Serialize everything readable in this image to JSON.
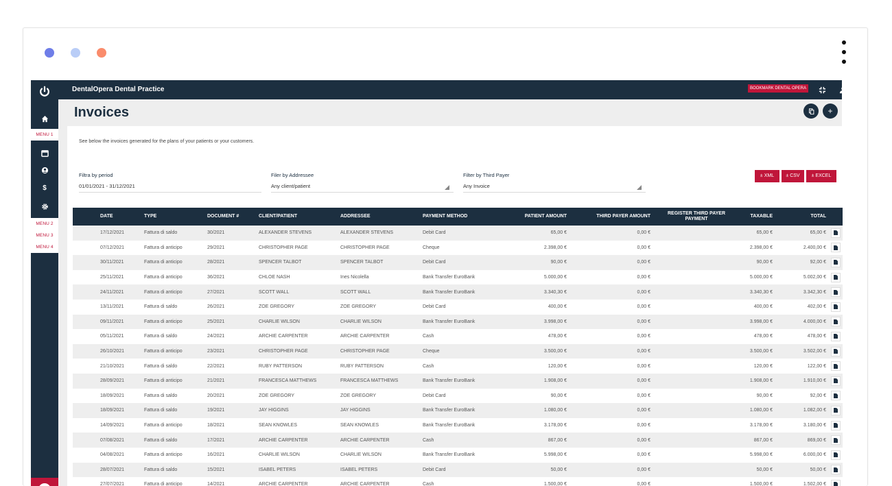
{
  "app": {
    "brand": "DentalOpera Dental Practice",
    "bookmark_label": "BOOKMARK DENTAL OPERA",
    "accent_color": "#c0163a",
    "nav_color": "#1c2f40"
  },
  "sidebar": {
    "menu1": "MENU 1",
    "menu2": "MENU 2",
    "menu3": "MENU 3",
    "menu4": "MENU 4",
    "icons": [
      "home-icon",
      "calendar-icon",
      "user-icon",
      "dollar-icon",
      "gear-icon"
    ]
  },
  "page": {
    "title": "Invoices",
    "subtitle": "See below the invoices generated for the plans of your patients or your customers."
  },
  "filters": {
    "period_label": "Filtra by period",
    "period_value": "01/01/2021 - 31/12/2021",
    "addressee_label": "Filer by Addressee",
    "addressee_value": "Any client/patient",
    "third_payer_label": "Filter by Third Payer",
    "third_payer_value": "Any Invoice"
  },
  "export": {
    "xml": "± XML",
    "csv": "± CSV",
    "excel": "± EXCEL"
  },
  "table": {
    "headers": {
      "date": "DATE",
      "type": "TYPE",
      "document": "DOCUMENT #",
      "client": "CLIENT/PATIENT",
      "addressee": "ADDRESSEE",
      "payment": "PAYMENT METHOD",
      "patient_amount": "PATIENT AMOUNT",
      "third_amount": "THIRD PAYER AMOUNT",
      "register": "REGISTER THIRD PAYER PAYMENT",
      "taxable": "TAXABLE",
      "total": "TOTAL"
    },
    "rows": [
      [
        "17/12/2021",
        "Fattura di saldo",
        "30/2021",
        "ALEXANDER STEVENS",
        "ALEXANDER STEVENS",
        "Debit Card",
        "65,00 €",
        "0,00 €",
        "",
        "65,00 €",
        "65,00 €"
      ],
      [
        "07/12/2021",
        "Fattura di anticipo",
        "29/2021",
        "CHRISTOPHER PAGE",
        "CHRISTOPHER PAGE",
        "Cheque",
        "2.398,00 €",
        "0,00 €",
        "",
        "2.398,00 €",
        "2.400,00 €"
      ],
      [
        "30/11/2021",
        "Fattura di anticipo",
        "28/2021",
        "SPENCER TALBOT",
        "SPENCER TALBOT",
        "Debit Card",
        "90,00 €",
        "0,00 €",
        "",
        "90,00 €",
        "92,00 €"
      ],
      [
        "25/11/2021",
        "Fattura di anticipo",
        "36/2021",
        "CHLOE NASH",
        "Ines Nicolella",
        "Bank Transfer EuroBank",
        "5.000,00 €",
        "0,00 €",
        "",
        "5.000,00 €",
        "5.002,00 €"
      ],
      [
        "24/11/2021",
        "Fattura di anticipo",
        "27/2021",
        "SCOTT WALL",
        "SCOTT WALL",
        "Bank Transfer EuroBank",
        "3.340,30 €",
        "0,00 €",
        "",
        "3.340,30 €",
        "3.342,30 €"
      ],
      [
        "13/11/2021",
        "Fattura di saldo",
        "26/2021",
        "ZOE GREGORY",
        "ZOE GREGORY",
        "Debit Card",
        "400,00 €",
        "0,00 €",
        "",
        "400,00 €",
        "402,00 €"
      ],
      [
        "09/11/2021",
        "Fattura di anticipo",
        "25/2021",
        "CHARLIE WILSON",
        "CHARLIE WILSON",
        "Bank Transfer EuroBank",
        "3.998,00 €",
        "0,00 €",
        "",
        "3.998,00 €",
        "4.000,00 €"
      ],
      [
        "05/11/2021",
        "Fattura di saldo",
        "24/2021",
        "ARCHIE CARPENTER",
        "ARCHIE CARPENTER",
        "Cash",
        "478,00 €",
        "0,00 €",
        "",
        "478,00 €",
        "478,00 €"
      ],
      [
        "26/10/2021",
        "Fattura di anticipo",
        "23/2021",
        "CHRISTOPHER PAGE",
        "CHRISTOPHER PAGE",
        "Cheque",
        "3.500,00 €",
        "0,00 €",
        "",
        "3.500,00 €",
        "3.502,00 €"
      ],
      [
        "21/10/2021",
        "Fattura di saldo",
        "22/2021",
        "RUBY PATTERSON",
        "RUBY PATTERSON",
        "Cash",
        "120,00 €",
        "0,00 €",
        "",
        "120,00 €",
        "122,00 €"
      ],
      [
        "28/09/2021",
        "Fattura di anticipo",
        "21/2021",
        "FRANCESCA MATTHEWS",
        "FRANCESCA MATTHEWS",
        "Bank Transfer EuroBank",
        "1.908,00 €",
        "0,00 €",
        "",
        "1.908,00 €",
        "1.910,00 €"
      ],
      [
        "18/09/2021",
        "Fattura di saldo",
        "20/2021",
        "ZOE GREGORY",
        "ZOE GREGORY",
        "Debit Card",
        "90,00 €",
        "0,00 €",
        "",
        "90,00 €",
        "92,00 €"
      ],
      [
        "18/09/2021",
        "Fattura di saldo",
        "19/2021",
        "JAY HIGGINS",
        "JAY HIGGINS",
        "Bank Transfer EuroBank",
        "1.080,00 €",
        "0,00 €",
        "",
        "1.080,00 €",
        "1.082,00 €"
      ],
      [
        "14/09/2021",
        "Fattura di anticipo",
        "18/2021",
        "SEAN KNOWLES",
        "SEAN KNOWLES",
        "Bank Transfer EuroBank",
        "3.178,00 €",
        "0,00 €",
        "",
        "3.178,00 €",
        "3.180,00 €"
      ],
      [
        "07/08/2021",
        "Fattura di saldo",
        "17/2021",
        "ARCHIE CARPENTER",
        "ARCHIE CARPENTER",
        "Cash",
        "867,00 €",
        "0,00 €",
        "",
        "867,00 €",
        "869,00 €"
      ],
      [
        "04/08/2021",
        "Fattura di anticipo",
        "16/2021",
        "CHARLIE WILSON",
        "CHARLIE WILSON",
        "Bank Transfer EuroBank",
        "5.998,00 €",
        "0,00 €",
        "",
        "5.998,00 €",
        "6.000,00 €"
      ],
      [
        "28/07/2021",
        "Fattura di saldo",
        "15/2021",
        "ISABEL PETERS",
        "ISABEL PETERS",
        "Debit Card",
        "50,00 €",
        "0,00 €",
        "",
        "50,00 €",
        "50,00 €"
      ],
      [
        "27/07/2021",
        "Fattura di anticipo",
        "14/2021",
        "ARCHIE CARPENTER",
        "ARCHIE CARPENTER",
        "Cash",
        "1.500,00 €",
        "0,00 €",
        "",
        "1.500,00 €",
        "1.502,00 €"
      ]
    ]
  }
}
